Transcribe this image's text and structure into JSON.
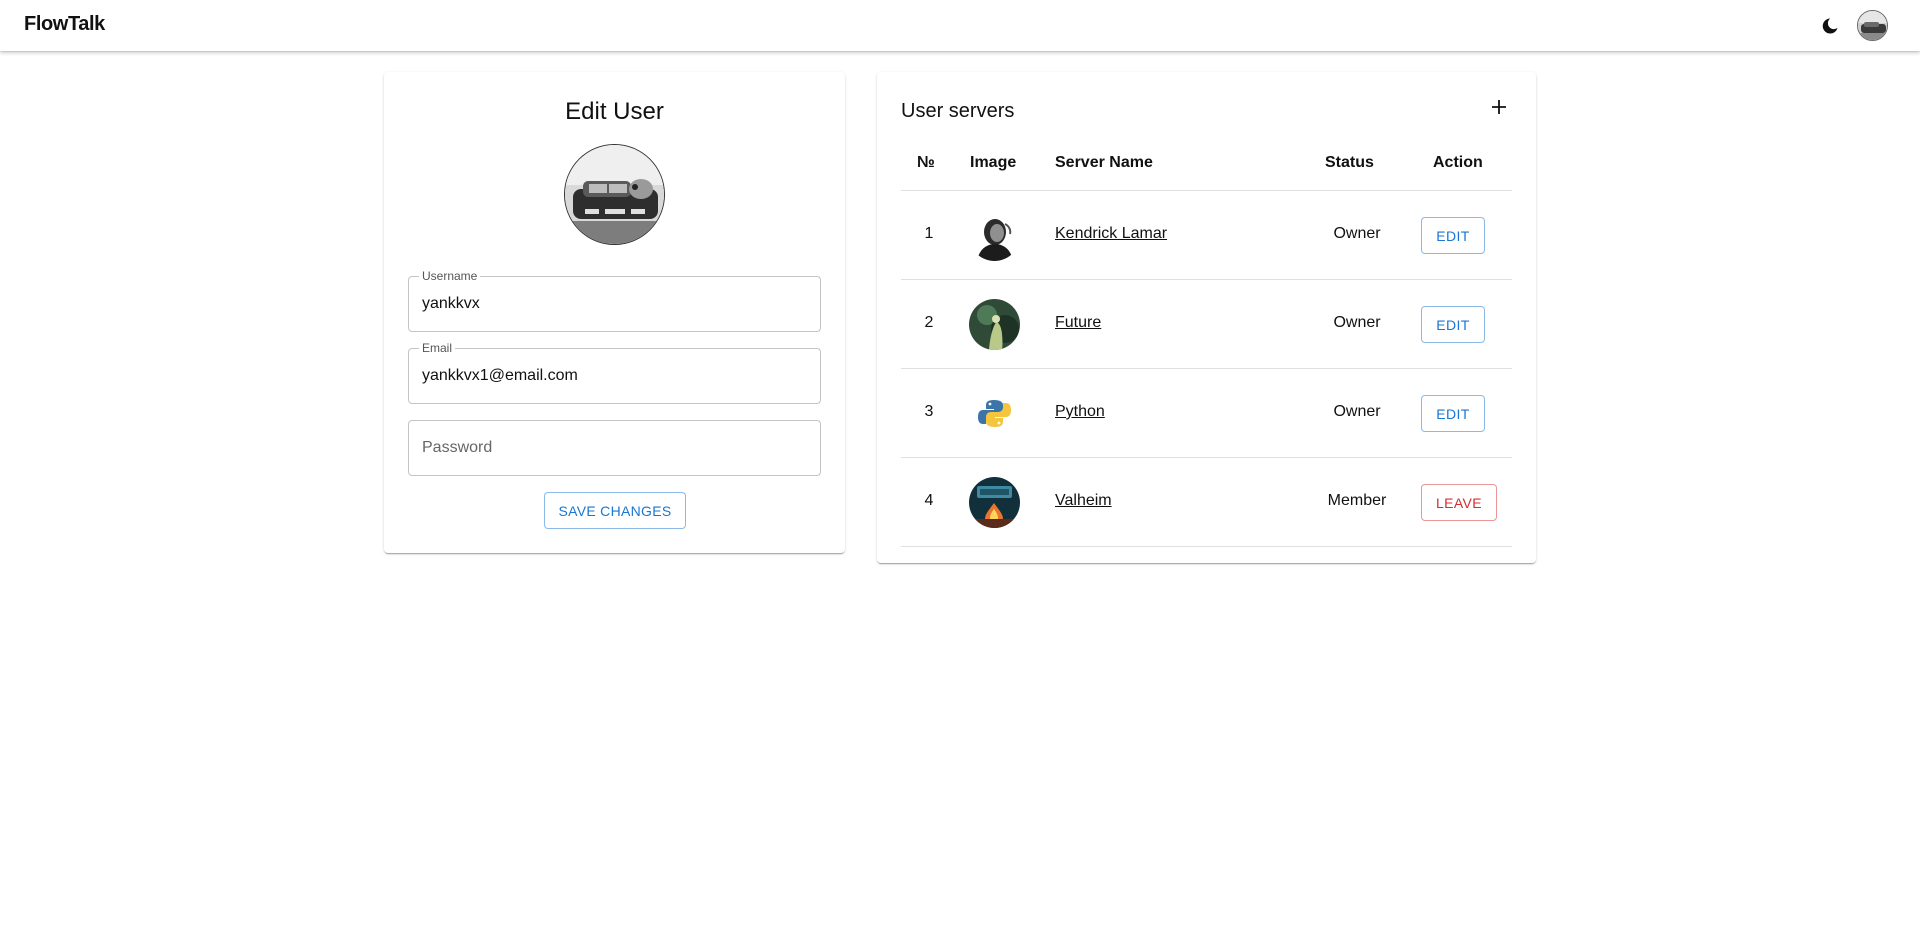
{
  "app": {
    "brand": "FlowTalk"
  },
  "topbar": {
    "theme_icon": "moon-icon",
    "avatar_icon": "user-avatar"
  },
  "edit_user": {
    "title": "Edit User",
    "username": {
      "label": "Username",
      "value": "yankkvx"
    },
    "email": {
      "label": "Email",
      "value": "yankkvx1@email.com"
    },
    "password": {
      "placeholder": "Password",
      "value": ""
    },
    "save_label": "SAVE CHANGES"
  },
  "servers": {
    "title": "User servers",
    "add_icon": "plus-icon",
    "columns": {
      "num": "№",
      "image": "Image",
      "name": "Server Name",
      "status": "Status",
      "action": "Action"
    },
    "rows": [
      {
        "num": "1",
        "name": "Kendrick Lamar",
        "status": "Owner",
        "action": "EDIT"
      },
      {
        "num": "2",
        "name": "Future",
        "status": "Owner",
        "action": "EDIT"
      },
      {
        "num": "3",
        "name": "Python",
        "status": "Owner",
        "action": "EDIT"
      },
      {
        "num": "4",
        "name": "Valheim",
        "status": "Member",
        "action": "LEAVE"
      }
    ]
  },
  "colors": {
    "primary": "#1976d2",
    "danger": "#d32f2f",
    "border": "#c4c4c4",
    "divider": "#e0e0e0"
  }
}
